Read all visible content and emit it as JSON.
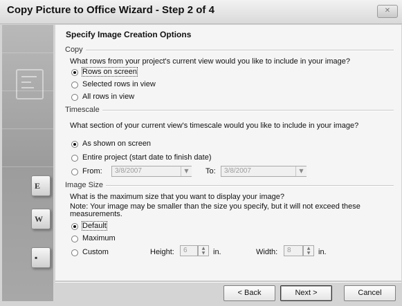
{
  "window": {
    "title": "Copy Picture to Office Wizard - Step 2 of 4",
    "close_icon": "close-icon"
  },
  "header": {
    "title": "Specify Image Creation Options"
  },
  "copy_group": {
    "label": "Copy",
    "question": "What rows from your project's current view would you like to include in your image?",
    "options": [
      {
        "label": "Rows on screen",
        "checked": true
      },
      {
        "label": "Selected rows in view",
        "checked": false
      },
      {
        "label": "All rows in view",
        "checked": false
      }
    ]
  },
  "timescale_group": {
    "label": "Timescale",
    "question": "What section of your current view's timescale would you like to include in your image?",
    "options": [
      {
        "label": "As shown on screen",
        "checked": true
      },
      {
        "label": "Entire project (start date to finish date)",
        "checked": false
      },
      {
        "label": "From:",
        "checked": false
      }
    ],
    "from_value": "3/8/2007",
    "to_label": "To:",
    "to_value": "3/8/2007"
  },
  "image_size_group": {
    "label": "Image Size",
    "question": "What is the maximum size that you want to display your image?",
    "note": "Note: Your image may be smaller than the size you specify, but it will not exceed these",
    "note_cont": "measurements.",
    "options": [
      {
        "label": "Default",
        "checked": true
      },
      {
        "label": "Maximum",
        "checked": false
      },
      {
        "label": "Custom",
        "checked": false
      }
    ],
    "height_label": "Height:",
    "height_value": "6",
    "height_unit": "in.",
    "width_label": "Width:",
    "width_value": "8",
    "width_unit": "in."
  },
  "buttons": {
    "back": "< Back",
    "next": "Next >",
    "cancel": "Cancel"
  },
  "banner_icons": [
    "excel-icon",
    "word-icon",
    "visio-icon"
  ]
}
